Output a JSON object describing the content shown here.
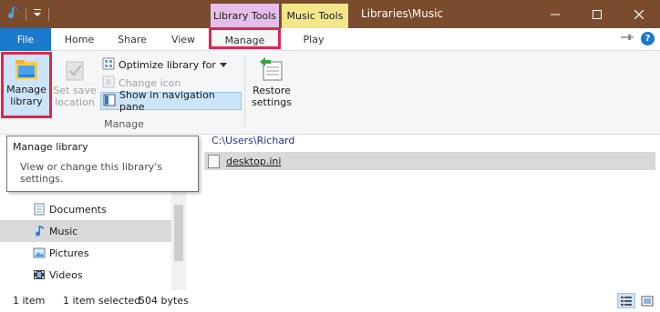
{
  "titlebar": {
    "window_title": "Libraries\\Music",
    "context_tabs": {
      "library_tools": "Library Tools",
      "music_tools": "Music Tools"
    },
    "buttons": {
      "minimize": "—",
      "maximize": "☐",
      "close": "✕"
    }
  },
  "tabs": {
    "file": "File",
    "home": "Home",
    "share": "Share",
    "view": "View",
    "manage": "Manage",
    "play": "Play"
  },
  "ribbon": {
    "manage_library": "Manage library",
    "set_save_location": "Set save location",
    "optimize_library_for": "Optimize library for",
    "change_icon": "Change icon",
    "show_in_navigation_pane": "Show in navigation pane",
    "group_label": "Manage",
    "restore_settings": "Restore settings"
  },
  "tooltip": {
    "title": "Manage library",
    "body": "View or change this library's settings."
  },
  "navigation": {
    "items": [
      {
        "label": "Documents",
        "icon": "documents-icon"
      },
      {
        "label": "Music",
        "icon": "music-icon",
        "selected": true
      },
      {
        "label": "Pictures",
        "icon": "pictures-icon"
      },
      {
        "label": "Videos",
        "icon": "videos-icon"
      }
    ]
  },
  "content": {
    "path": "C:\\Users\\Richard",
    "files": [
      {
        "name": "desktop.ini",
        "icon": "ini-file-icon"
      }
    ]
  },
  "status": {
    "item_count": "1 item",
    "selected": "1 item selected",
    "size": "504 bytes"
  },
  "colors": {
    "titlebar": "#7a4b2c",
    "file_tab": "#1979ca",
    "library_tools": "#e5bfea",
    "music_tools": "#f3e78a",
    "highlight": "#e0264d",
    "selection": "#cce4f7"
  }
}
